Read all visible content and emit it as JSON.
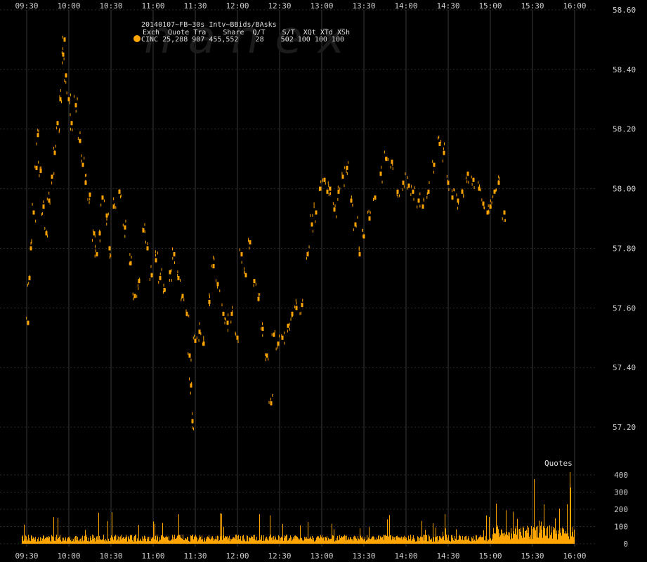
{
  "watermark": "nanex",
  "colors": {
    "background": "#000000",
    "series": "#FFA500",
    "grid": "#2a2a2a",
    "vgrid": "#3a3a3a",
    "text": "#cfcfcf"
  },
  "legend": {
    "title": "20140107~FB~30s Intv~BBids/BAsks",
    "header": "Exch  Quote Tra    Share  Q/T    S/T  XQt XTd XSh",
    "row": "CINC 25,288 907 455,552    28    502 100 100 100"
  },
  "chart_data": [
    {
      "type": "scatter",
      "title": "",
      "xlabel": "",
      "ylabel": "",
      "x_ticks": [
        "09:30",
        "10:00",
        "10:30",
        "11:00",
        "11:30",
        "12:00",
        "12:30",
        "13:00",
        "13:30",
        "14:00",
        "14:30",
        "15:00",
        "15:30",
        "16:00"
      ],
      "y_ticks": [
        "58.60",
        "58.40",
        "58.20",
        "58.00",
        "57.80",
        "57.60",
        "57.40",
        "57.20"
      ],
      "xlim": [
        "09:30",
        "16:00"
      ],
      "ylim": [
        57.12,
        58.6
      ],
      "grid": true,
      "series": [
        {
          "name": "CINC",
          "points": [
            [
              "09:31",
              57.55
            ],
            [
              "09:32",
              57.7
            ],
            [
              "09:33",
              57.8
            ],
            [
              "09:35",
              57.92
            ],
            [
              "09:37",
              58.07
            ],
            [
              "09:38",
              58.18
            ],
            [
              "09:40",
              58.06
            ],
            [
              "09:42",
              57.94
            ],
            [
              "09:44",
              57.85
            ],
            [
              "09:46",
              57.96
            ],
            [
              "09:48",
              58.04
            ],
            [
              "09:50",
              58.12
            ],
            [
              "09:52",
              58.22
            ],
            [
              "09:54",
              58.3
            ],
            [
              "09:56",
              58.45
            ],
            [
              "09:57",
              58.5
            ],
            [
              "09:58",
              58.38
            ],
            [
              "10:00",
              58.3
            ],
            [
              "10:02",
              58.22
            ],
            [
              "10:05",
              58.28
            ],
            [
              "10:08",
              58.16
            ],
            [
              "10:10",
              58.08
            ],
            [
              "10:12",
              58.02
            ],
            [
              "10:15",
              57.98
            ],
            [
              "10:18",
              57.85
            ],
            [
              "10:20",
              57.78
            ],
            [
              "10:22",
              57.85
            ],
            [
              "10:24",
              57.97
            ],
            [
              "10:27",
              57.91
            ],
            [
              "10:29",
              57.8
            ],
            [
              "10:32",
              57.94
            ],
            [
              "10:36",
              57.99
            ],
            [
              "10:40",
              57.87
            ],
            [
              "10:44",
              57.75
            ],
            [
              "10:47",
              57.64
            ],
            [
              "10:50",
              57.69
            ],
            [
              "10:53",
              57.86
            ],
            [
              "10:56",
              57.8
            ],
            [
              "10:59",
              57.71
            ],
            [
              "11:02",
              57.76
            ],
            [
              "11:05",
              57.7
            ],
            [
              "11:08",
              57.66
            ],
            [
              "11:12",
              57.72
            ],
            [
              "11:15",
              57.78
            ],
            [
              "11:18",
              57.7
            ],
            [
              "11:21",
              57.64
            ],
            [
              "11:24",
              57.58
            ],
            [
              "11:26",
              57.44
            ],
            [
              "11:27",
              57.34
            ],
            [
              "11:28",
              57.22
            ],
            [
              "11:30",
              57.49
            ],
            [
              "11:33",
              57.52
            ],
            [
              "11:36",
              57.48
            ],
            [
              "11:40",
              57.62
            ],
            [
              "11:43",
              57.74
            ],
            [
              "11:46",
              57.68
            ],
            [
              "11:50",
              57.58
            ],
            [
              "11:53",
              57.55
            ],
            [
              "11:56",
              57.58
            ],
            [
              "12:00",
              57.5
            ],
            [
              "12:03",
              57.78
            ],
            [
              "12:06",
              57.71
            ],
            [
              "12:09",
              57.82
            ],
            [
              "12:12",
              57.69
            ],
            [
              "12:15",
              57.63
            ],
            [
              "12:18",
              57.53
            ],
            [
              "12:21",
              57.44
            ],
            [
              "12:24",
              57.28
            ],
            [
              "12:26",
              57.51
            ],
            [
              "12:29",
              57.48
            ],
            [
              "12:32",
              57.5
            ],
            [
              "12:36",
              57.54
            ],
            [
              "12:39",
              57.58
            ],
            [
              "12:42",
              57.6
            ],
            [
              "12:46",
              57.61
            ],
            [
              "12:50",
              57.78
            ],
            [
              "12:53",
              57.88
            ],
            [
              "12:56",
              57.92
            ],
            [
              "12:59",
              58.0
            ],
            [
              "13:02",
              58.03
            ],
            [
              "13:04",
              57.99
            ],
            [
              "13:06",
              58.0
            ],
            [
              "13:09",
              57.93
            ],
            [
              "13:12",
              57.99
            ],
            [
              "13:15",
              58.04
            ],
            [
              "13:18",
              58.07
            ],
            [
              "13:21",
              57.96
            ],
            [
              "13:24",
              57.88
            ],
            [
              "13:27",
              57.78
            ],
            [
              "13:30",
              57.84
            ],
            [
              "13:34",
              57.9
            ],
            [
              "13:38",
              57.97
            ],
            [
              "13:42",
              58.05
            ],
            [
              "13:46",
              58.1
            ],
            [
              "13:50",
              58.09
            ],
            [
              "13:54",
              57.99
            ],
            [
              "13:58",
              58.02
            ],
            [
              "14:02",
              58.01
            ],
            [
              "14:05",
              57.99
            ],
            [
              "14:09",
              57.96
            ],
            [
              "14:12",
              57.94
            ],
            [
              "14:16",
              57.99
            ],
            [
              "14:20",
              58.08
            ],
            [
              "14:24",
              58.15
            ],
            [
              "14:27",
              58.12
            ],
            [
              "14:30",
              58.02
            ],
            [
              "14:33",
              57.97
            ],
            [
              "14:37",
              57.96
            ],
            [
              "14:40",
              57.99
            ],
            [
              "14:44",
              58.05
            ],
            [
              "14:48",
              58.03
            ],
            [
              "14:52",
              58.0
            ],
            [
              "14:55",
              57.95
            ],
            [
              "14:58",
              57.92
            ],
            [
              "15:00",
              57.94
            ],
            [
              "15:03",
              57.99
            ],
            [
              "15:06",
              58.02
            ],
            [
              "15:10",
              57.92
            ]
          ]
        }
      ]
    },
    {
      "type": "bar",
      "title": "Quotes",
      "y_ticks": [
        0,
        100,
        200,
        300,
        400
      ],
      "ylim": [
        0,
        440
      ],
      "series": [
        {
          "name": "Quotes",
          "values": []
        }
      ]
    }
  ]
}
